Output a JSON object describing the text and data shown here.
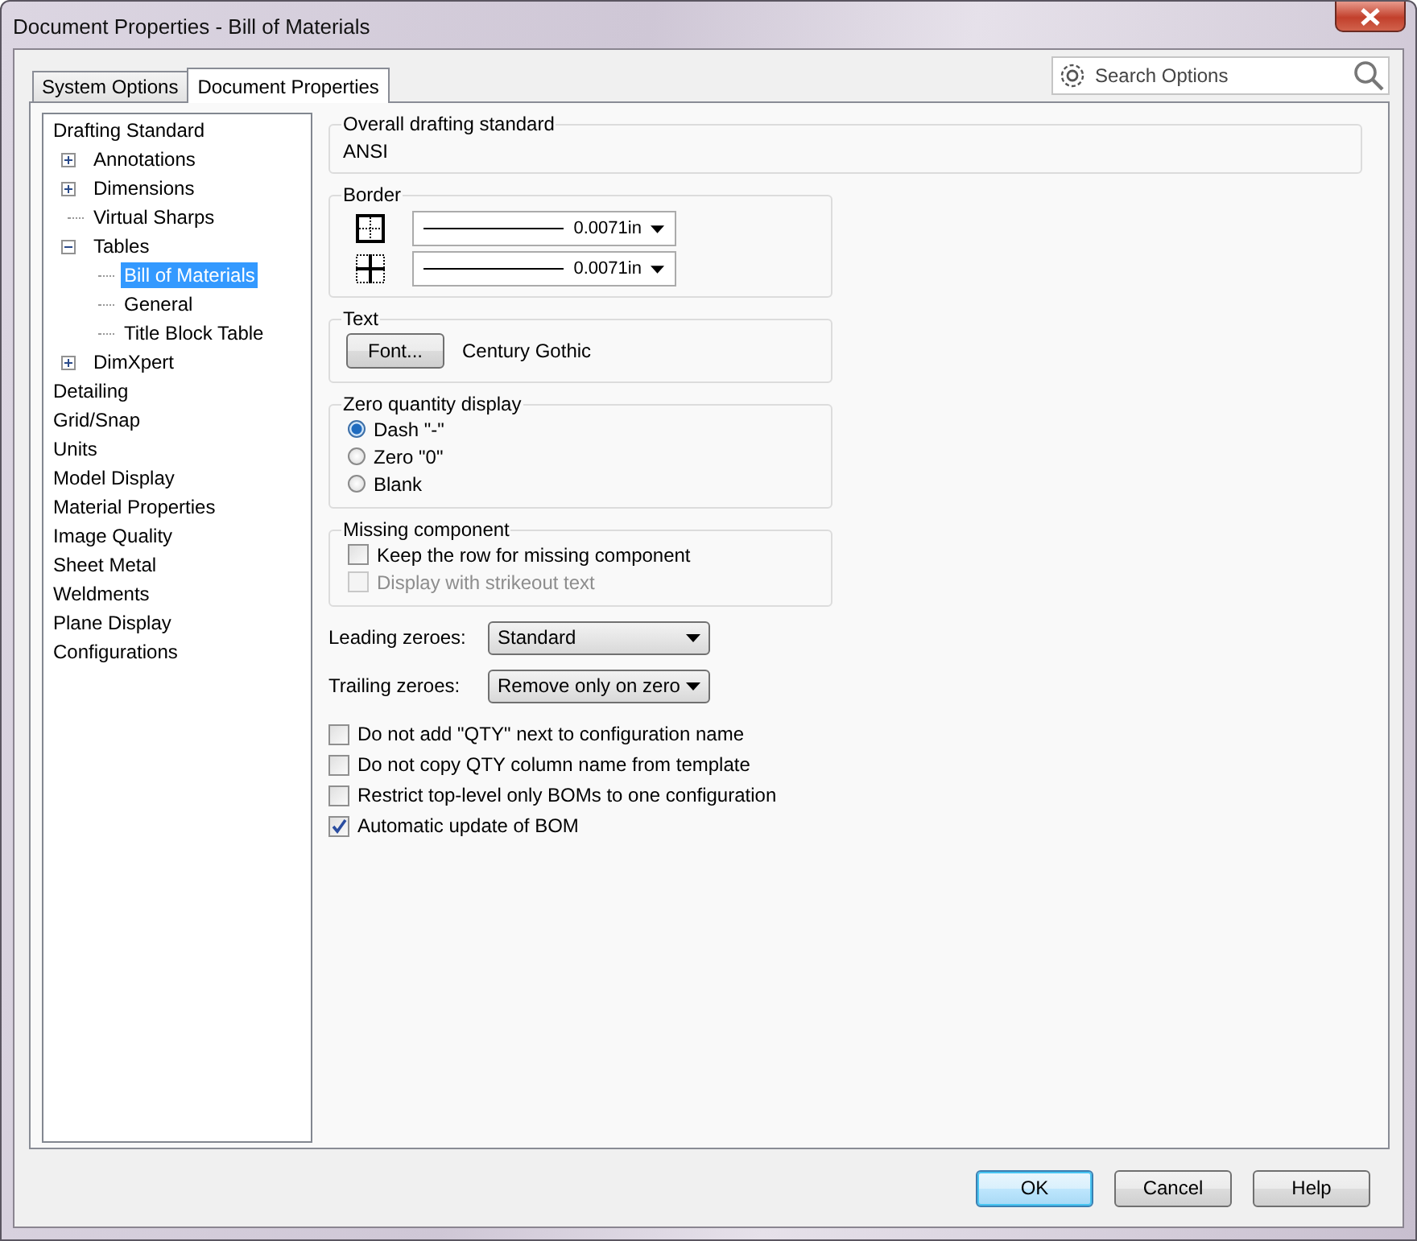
{
  "window": {
    "title": "Document Properties - Bill of Materials"
  },
  "tabs": [
    {
      "label": "System Options",
      "selected": false
    },
    {
      "label": "Document Properties",
      "selected": true
    }
  ],
  "search": {
    "placeholder": "Search Options"
  },
  "tree": [
    {
      "label": "Drafting Standard",
      "selected": false,
      "children": [
        {
          "label": "Annotations",
          "selected": false,
          "expanded": false
        },
        {
          "label": "Dimensions",
          "selected": false,
          "expanded": false
        },
        {
          "label": "Virtual Sharps",
          "selected": false
        },
        {
          "label": "Tables",
          "selected": false,
          "expanded": true,
          "children": [
            {
              "label": "Bill of Materials",
              "selected": true
            },
            {
              "label": "General",
              "selected": false
            },
            {
              "label": "Title Block Table",
              "selected": false
            }
          ]
        },
        {
          "label": "DimXpert",
          "selected": false,
          "expanded": false
        }
      ]
    },
    {
      "label": "Detailing",
      "selected": false
    },
    {
      "label": "Grid/Snap",
      "selected": false
    },
    {
      "label": "Units",
      "selected": false
    },
    {
      "label": "Model Display",
      "selected": false
    },
    {
      "label": "Material Properties",
      "selected": false
    },
    {
      "label": "Image Quality",
      "selected": false
    },
    {
      "label": "Sheet Metal",
      "selected": false
    },
    {
      "label": "Weldments",
      "selected": false
    },
    {
      "label": "Plane Display",
      "selected": false
    },
    {
      "label": "Configurations",
      "selected": false
    }
  ],
  "overall_drafting_standard": {
    "label": "Overall drafting standard",
    "value": "ANSI"
  },
  "border": {
    "label": "Border",
    "rows": [
      {
        "kind": "outer",
        "value": "0.0071in"
      },
      {
        "kind": "inner",
        "value": "0.0071in"
      }
    ]
  },
  "text": {
    "label": "Text",
    "button": "Font...",
    "font": "Century Gothic"
  },
  "zero_quantity_display": {
    "label": "Zero quantity display",
    "options": [
      {
        "label": "Dash \"-\"",
        "selected": true
      },
      {
        "label": "Zero \"0\"",
        "selected": false
      },
      {
        "label": "Blank",
        "selected": false
      }
    ]
  },
  "missing_component": {
    "label": "Missing component",
    "options": [
      {
        "label": "Keep the row for missing component",
        "checked": false,
        "disabled": false
      },
      {
        "label": "Display with strikeout text",
        "checked": false,
        "disabled": true
      }
    ]
  },
  "leading_zeroes": {
    "label": "Leading zeroes:",
    "value": "Standard"
  },
  "trailing_zeroes": {
    "label": "Trailing zeroes:",
    "value": "Remove only on zero"
  },
  "checkboxes": [
    {
      "label": "Do not add \"QTY\" next to configuration name",
      "checked": false
    },
    {
      "label": "Do not copy QTY column name from template",
      "checked": false
    },
    {
      "label": "Restrict top-level only BOMs to one configuration",
      "checked": false
    },
    {
      "label": "Automatic update of BOM",
      "checked": true
    }
  ],
  "buttons": [
    {
      "label": "OK",
      "default": true
    },
    {
      "label": "Cancel",
      "default": false
    },
    {
      "label": "Help",
      "default": false
    }
  ]
}
